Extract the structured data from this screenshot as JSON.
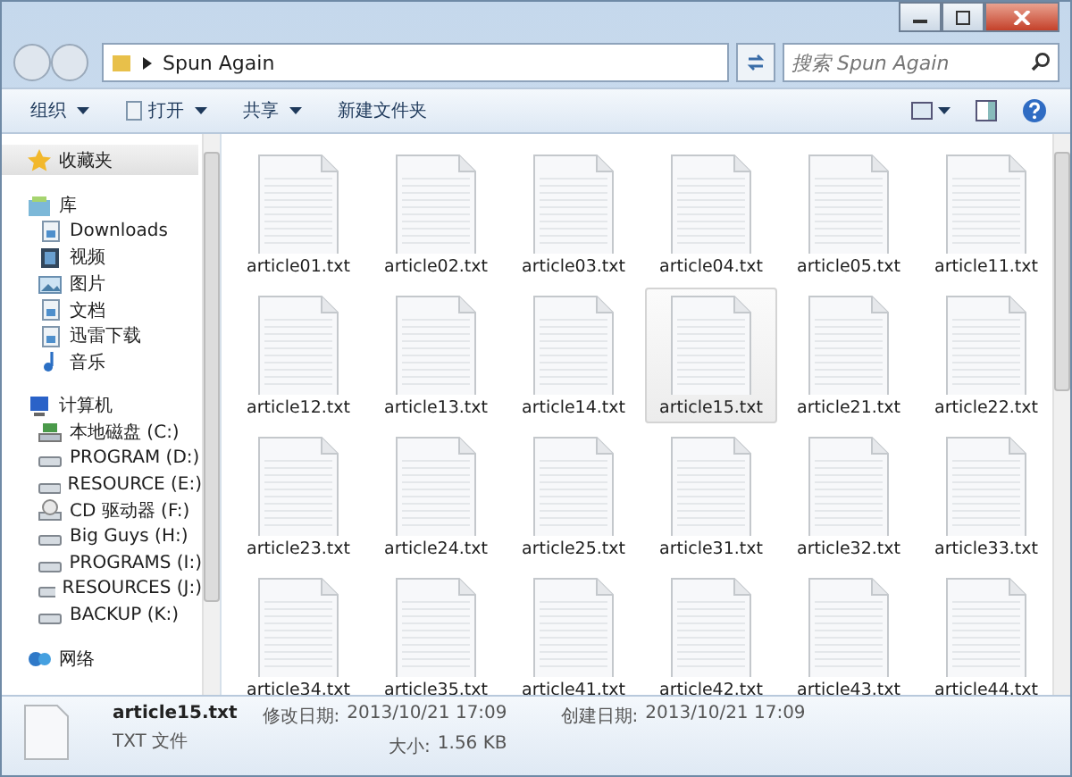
{
  "address_bar": {
    "path": "Spun Again"
  },
  "search": {
    "placeholder": "搜索 Spun Again"
  },
  "toolbar": [
    {
      "label": "组织",
      "dropdown": true,
      "kind": "plain"
    },
    {
      "label": "打开",
      "dropdown": true,
      "kind": "open"
    },
    {
      "label": "共享",
      "dropdown": true,
      "kind": "plain"
    },
    {
      "label": "新建文件夹",
      "dropdown": false,
      "kind": "plain"
    }
  ],
  "sidebar": {
    "items": [
      {
        "label": "收藏夹",
        "kind": "star",
        "selected": true
      },
      {
        "label": "库",
        "kind": "library",
        "selected": false,
        "children": [
          {
            "label": "Downloads",
            "kind": "doc",
            "selected": false
          },
          {
            "label": "视频",
            "kind": "video",
            "selected": false
          },
          {
            "label": "图片",
            "kind": "picture",
            "selected": false
          },
          {
            "label": "文档",
            "kind": "doc",
            "selected": false
          },
          {
            "label": "迅雷下载",
            "kind": "doc",
            "selected": false
          },
          {
            "label": "音乐",
            "kind": "music",
            "selected": false
          }
        ]
      },
      {
        "label": "计算机",
        "kind": "computer",
        "selected": false,
        "children": [
          {
            "label": "本地磁盘 (C:)",
            "kind": "system",
            "selected": false
          },
          {
            "label": "PROGRAM (D:)",
            "kind": "drive",
            "selected": false
          },
          {
            "label": "RESOURCE (E:)",
            "kind": "drive",
            "selected": false
          },
          {
            "label": "CD 驱动器 (F:)",
            "kind": "cd",
            "selected": false
          },
          {
            "label": "Big Guys (H:)",
            "kind": "drive",
            "selected": false
          },
          {
            "label": "PROGRAMS (I:)",
            "kind": "drive",
            "selected": false
          },
          {
            "label": "RESOURCES (J:)",
            "kind": "drive",
            "selected": false
          },
          {
            "label": "BACKUP (K:)",
            "kind": "drive",
            "selected": false
          }
        ]
      },
      {
        "label": "网络",
        "kind": "network",
        "selected": false
      }
    ]
  },
  "files": [
    {
      "name": "article01.txt",
      "selected": false
    },
    {
      "name": "article02.txt",
      "selected": false
    },
    {
      "name": "article03.txt",
      "selected": false
    },
    {
      "name": "article04.txt",
      "selected": false
    },
    {
      "name": "article05.txt",
      "selected": false
    },
    {
      "name": "article11.txt",
      "selected": false
    },
    {
      "name": "article12.txt",
      "selected": false
    },
    {
      "name": "article13.txt",
      "selected": false
    },
    {
      "name": "article14.txt",
      "selected": false
    },
    {
      "name": "article15.txt",
      "selected": true
    },
    {
      "name": "article21.txt",
      "selected": false
    },
    {
      "name": "article22.txt",
      "selected": false
    },
    {
      "name": "article23.txt",
      "selected": false
    },
    {
      "name": "article24.txt",
      "selected": false
    },
    {
      "name": "article25.txt",
      "selected": false
    },
    {
      "name": "article31.txt",
      "selected": false
    },
    {
      "name": "article32.txt",
      "selected": false
    },
    {
      "name": "article33.txt",
      "selected": false
    },
    {
      "name": "article34.txt",
      "selected": false
    },
    {
      "name": "article35.txt",
      "selected": false
    },
    {
      "name": "article41.txt",
      "selected": false
    },
    {
      "name": "article42.txt",
      "selected": false
    },
    {
      "name": "article43.txt",
      "selected": false
    },
    {
      "name": "article44.txt",
      "selected": false
    }
  ],
  "details": {
    "name": "article15.txt",
    "type": "TXT 文件",
    "fields": [
      {
        "label": "修改日期:",
        "value": "2013/10/21 17:09"
      },
      {
        "label": "大小:",
        "value": "1.56 KB"
      },
      {
        "label": "创建日期:",
        "value": "2013/10/21 17:09"
      }
    ]
  }
}
